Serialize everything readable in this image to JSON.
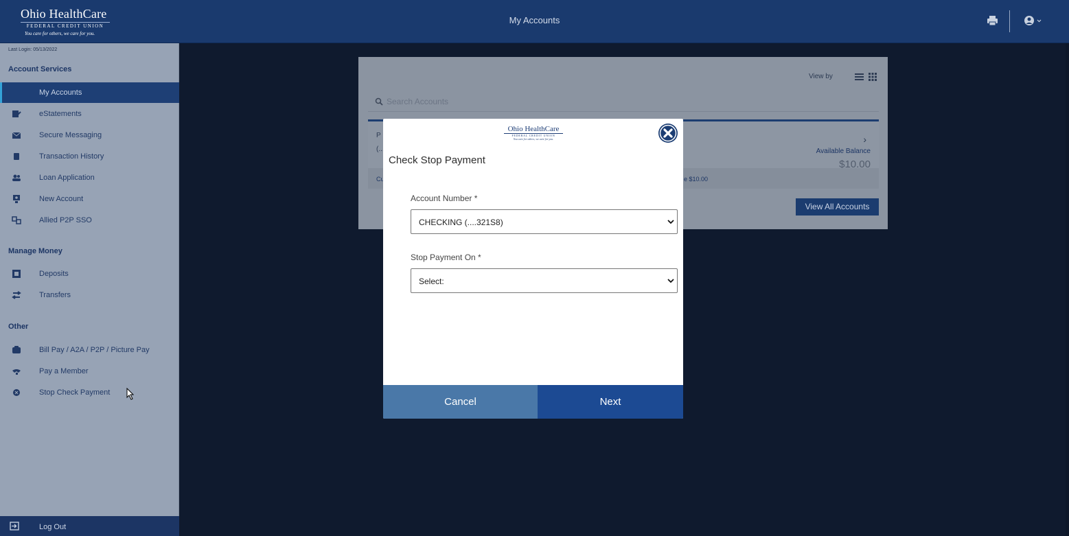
{
  "header": {
    "logo_line1": "Ohio HealthCare",
    "logo_line2": "FEDERAL CREDIT UNION",
    "logo_tagline": "You care for others, we care for you.",
    "title": "My Accounts",
    "print_icon": "print-icon",
    "user_icon": "user-circle-icon"
  },
  "sidebar": {
    "last_login": "Last Login: 05/13/2022",
    "sections": [
      {
        "heading": "Account Services"
      },
      {
        "heading": "Manage Money"
      },
      {
        "heading": "Other"
      }
    ],
    "items": [
      {
        "label": "My Accounts",
        "icon": "",
        "active": true
      },
      {
        "label": "eStatements",
        "icon": "document-edit-icon"
      },
      {
        "label": "Secure Messaging",
        "icon": "envelope-icon"
      },
      {
        "label": "Transaction History",
        "icon": "book-icon"
      },
      {
        "label": "Loan Application",
        "icon": "users-icon"
      },
      {
        "label": "New Account",
        "icon": "id-badge-icon"
      },
      {
        "label": "Allied P2P SSO",
        "icon": "transfer-icon"
      },
      {
        "label": "Deposits",
        "icon": "deposit-icon"
      },
      {
        "label": "Transfers",
        "icon": "exchange-icon"
      },
      {
        "label": "Bill Pay / A2A / P2P / Picture Pay",
        "icon": "bill-icon"
      },
      {
        "label": "Pay a Member",
        "icon": "hand-pay-icon"
      },
      {
        "label": "Stop Check Payment",
        "icon": "stop-icon"
      }
    ],
    "logout": "Log Out"
  },
  "background": {
    "view_by": "View by",
    "search_placeholder": "Search Accounts",
    "account_frag_1": "P",
    "account_frag_2": "(...",
    "account_frag_3": "Cu",
    "available_balance_label": "Available Balance",
    "available_balance": "$10.00",
    "available_fragment": "e $10.00",
    "view_all": "View All Accounts"
  },
  "modal": {
    "logo_line1": "Ohio HealthCare",
    "logo_line2": "FEDERAL CREDIT UNION",
    "logo_tagline": "You care for others, we care for you.",
    "title": "Check Stop Payment",
    "account_number_label": "Account Number *",
    "account_number_value": "CHECKING (....321S8)",
    "stop_payment_label": "Stop Payment On *",
    "stop_payment_value": "Select:",
    "cancel": "Cancel",
    "next": "Next"
  },
  "colors": {
    "header_bg": "#1a3a6e",
    "sidebar_bg": "#97a3b5",
    "active_item_bg": "#1e3f75",
    "cancel_bg": "#4a78a8",
    "next_bg": "#1c4a93",
    "overlay_bg": "#0f1a2e"
  }
}
